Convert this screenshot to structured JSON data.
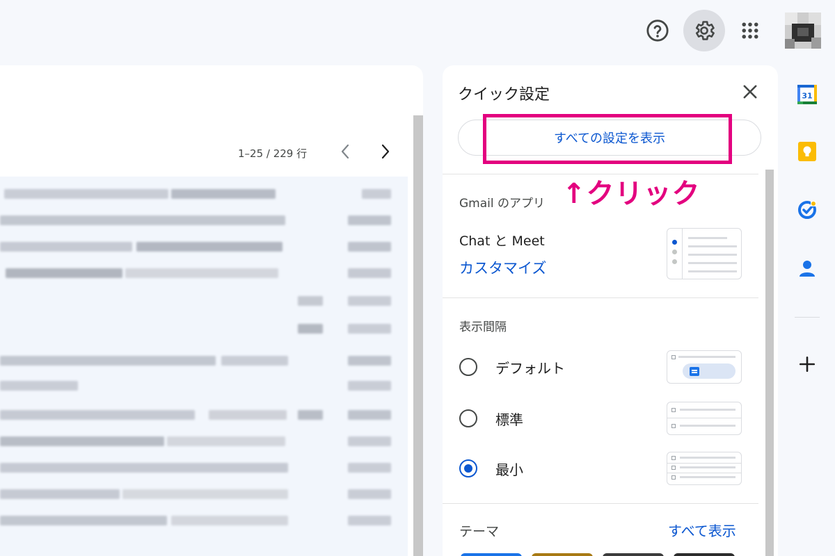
{
  "topbar": {
    "help_icon": "help-circle-icon",
    "settings_icon": "gear-icon",
    "apps_icon": "apps-grid-icon"
  },
  "mail_list": {
    "pagination_text": "1–25 / 229 行",
    "prev_icon": "chevron-left-icon",
    "next_icon": "chevron-right-icon"
  },
  "quick_settings": {
    "title": "クイック設定",
    "close_icon": "close-icon",
    "all_settings_button": "すべての設定を表示",
    "apps_section": {
      "heading": "Gmail のアプリ",
      "chat_meet_label": "Chat と Meet",
      "customize_link": "カスタマイズ"
    },
    "density_section": {
      "heading": "表示間隔",
      "options": [
        {
          "label": "デフォルト",
          "checked": false
        },
        {
          "label": "標準",
          "checked": false
        },
        {
          "label": "最小",
          "checked": true
        }
      ]
    },
    "theme_section": {
      "heading": "テーマ",
      "view_all_link": "すべて表示"
    }
  },
  "side_rail": {
    "icons": [
      "calendar-icon",
      "keep-icon",
      "tasks-icon",
      "contacts-icon",
      "add-icon"
    ],
    "calendar_day": "31"
  },
  "annotation": {
    "click_text": "↑クリック",
    "highlight_color": "#e3007f"
  },
  "colors": {
    "accent": "#0b57d0",
    "annotation": "#e3007f",
    "background": "#f6f8fc"
  }
}
